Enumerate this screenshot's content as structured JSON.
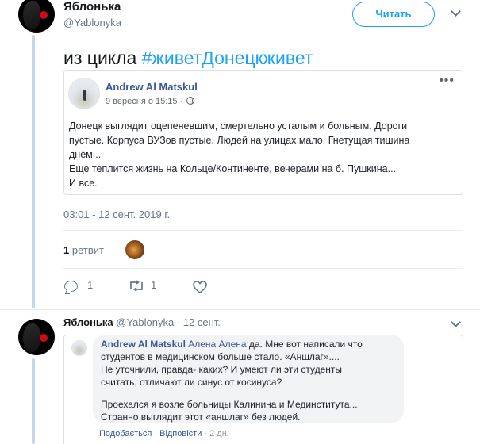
{
  "colors": {
    "accent": "#1da1f2",
    "fb_link": "#385898",
    "muted": "#657786",
    "thread": "#c4d7e9"
  },
  "header": {
    "name": "Яблонька",
    "handle": "@Yablonyka",
    "follow_label": "Читать"
  },
  "tweet": {
    "text_prefix": "из цикла ",
    "hashtag": "#живетДонецкживет"
  },
  "embed": {
    "author": "Andrew Al Matskul",
    "date": "9 вересня о 15:15 ·",
    "more": "•••",
    "lines": [
      "Донецк выглядит оцепеневшим, смертельно усталым и больным. Дороги",
      "пустые. Корпуса ВУЗов пустые. Людей на улицах мало. Гнетущая тишина",
      "днём...",
      "Еще теплится жизнь на Кольце/Континенте, вечерами на б. Пушкина...",
      "И все."
    ]
  },
  "meta": {
    "timestamp": "03:01 - 12 сент. 2019 г.",
    "retweet_count": "1",
    "retweet_label": " ретвит"
  },
  "actions": {
    "reply_count": "1",
    "retweet_count": "1"
  },
  "reply": {
    "name": "Яблонька",
    "handle_time": " @Yablonyka · 12 сент.",
    "comment": {
      "author": "Andrew Al Matskul",
      "mention": "Алена Алена",
      "line1_rest": " да. Мне вот написали что",
      "lines": [
        "студентов в медицинском больше стало. «Аншлаг»....",
        "Не уточнили, правда- каких? И умеют ли эти студенты",
        "считать, отличают ли синус от косинуса?"
      ],
      "lines2": [
        "Проехался я возле больницы Калинина и Мединститута...",
        "Странно выглядит этот «аншлаг» без людей."
      ],
      "like": "Подобається",
      "sep": " · ",
      "reply": "Відповісти",
      "time": " · 2 дн."
    }
  }
}
